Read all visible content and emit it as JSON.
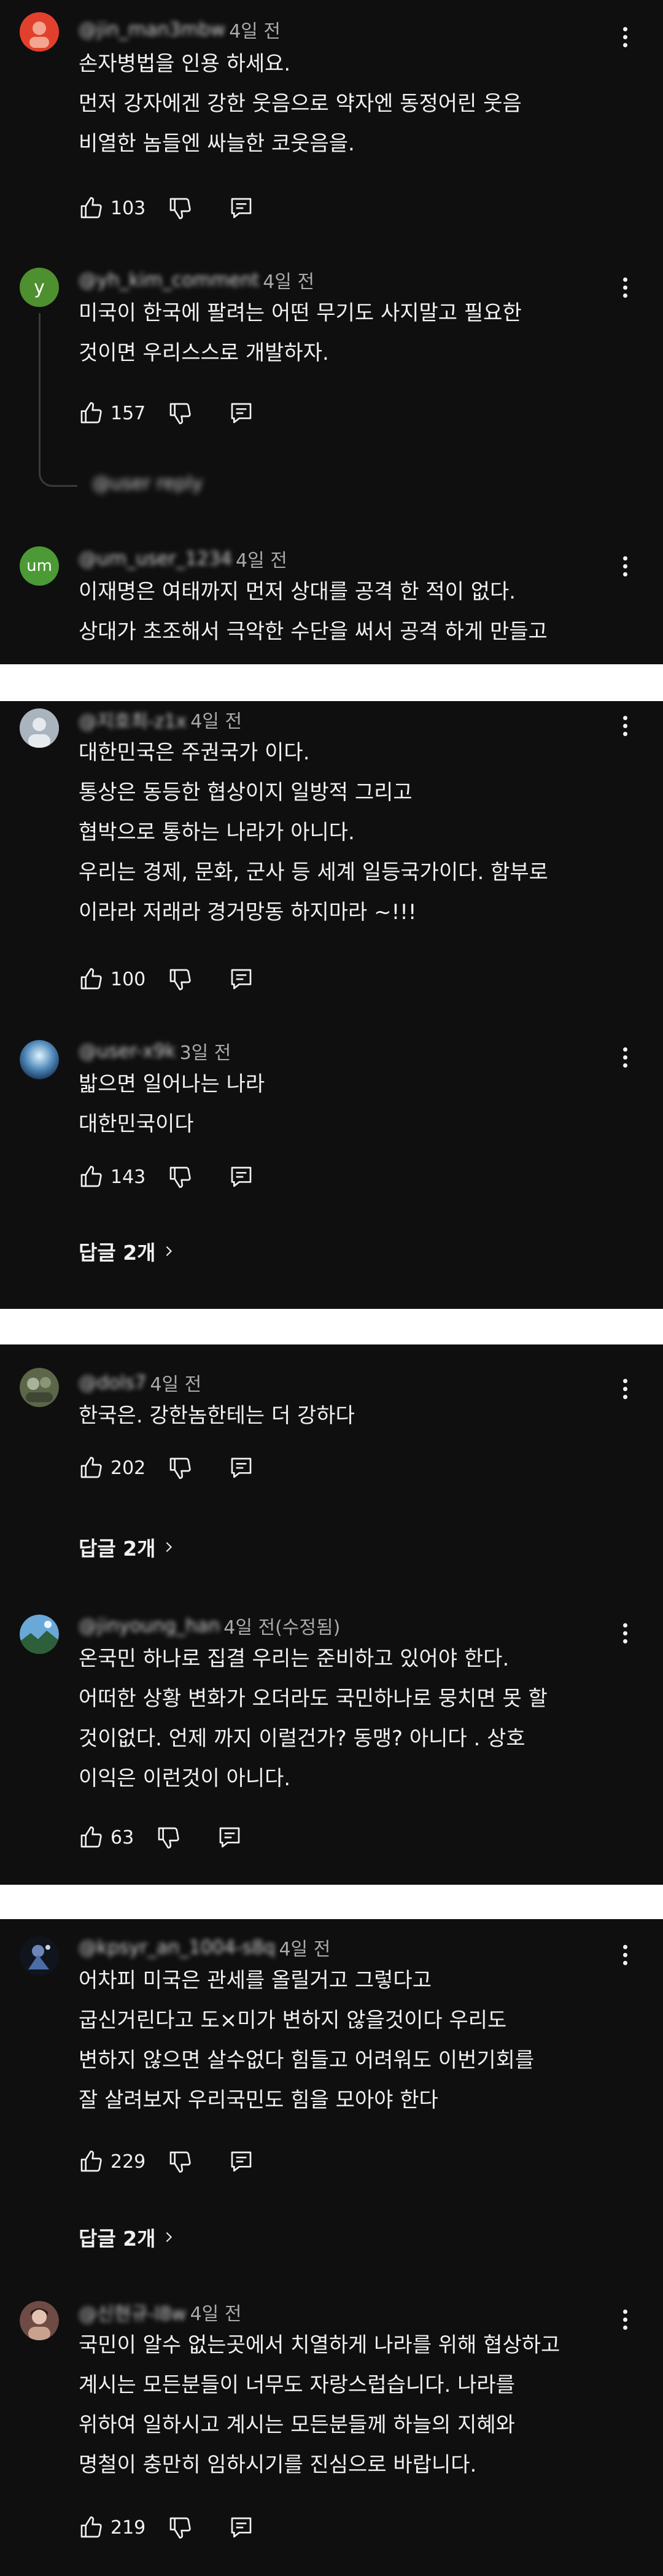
{
  "comments": [
    {
      "handle": "@jin_man3mbw",
      "age": "4일 전",
      "text": "손자병법을 인용 하세요.\n먼저 강자에겐 강한 웃음으로 약자엔 동정어린 웃음\n비열한 놈들엔 싸늘한 코웃음을.",
      "likes": "103"
    },
    {
      "avatar_letter": "y",
      "handle": "@yh_kim_comment",
      "age": "4일 전",
      "text": "미국이 한국에 팔려는 어떤 무기도 사지말고 필요한\n것이면 우리스스로 개발하자.",
      "likes": "157",
      "reply_preview": "@user reply"
    },
    {
      "avatar_letter": "um",
      "handle": "@um_user_1234",
      "age": "4일 전",
      "text": "이재명은 여태까지 먼저 상대를 공격 한 적이 없다.\n상대가 초조해서 극악한 수단을 써서 공격 하게 만들고"
    },
    {
      "handle": "@지호최-z1x",
      "age": "4일 전",
      "text": "대한민국은 주권국가 이다.\n통상은 동등한 협상이지 일방적 그리고\n협박으로 통하는 나라가 아니다.\n우리는 경제, 문화, 군사 등 세계 일등국가이다.  함부로\n이라라 저래라 경거망동 하지마라 ~!!!",
      "likes": "100"
    },
    {
      "handle": "@user-x9k",
      "age": "3일 전",
      "text": "밟으면 일어나는 나라\n대한민국이다",
      "likes": "143",
      "replies": "답글 2개"
    },
    {
      "handle": "@dols7",
      "age": "4일 전",
      "text": "한국은. 강한놈한테는 더 강하다",
      "likes": "202",
      "replies": "답글 2개"
    },
    {
      "handle": "@jinyoung_han",
      "age": "4일 전(수정됨)",
      "text": "온국민 하나로 집결  우리는 준비하고 있어야 한다.\n어떠한 상황 변화가 오더라도 국민하나로 뭉치면  못 할\n것이없다. 언제 까지 이럴건가?  동맹?  아니다 . 상호\n이익은 이런것이 아니다.",
      "likes": "63"
    },
    {
      "handle": "@kpsyr_an_1004-s8q",
      "age": "4일 전",
      "text": "어차피  미국은  관세를 올릴거고  그렇다고\n굽신거린다고  도×미가 변하지  않을것이다  우리도\n변하지  않으면  살수없다  힘들고  어려워도 이번기회를\n잘  살려보자  우리국민도  힘을  모아야 한다",
      "likes": "229",
      "replies": "답글 2개"
    },
    {
      "handle": "@신현규-l8w",
      "age": "4일 전",
      "text": "국민이 알수 없는곳에서 치열하게 나라를 위해 협상하고\n계시는 모든분들이 너무도 자랑스럽습니다. 나라를\n위하여 일하시고 계시는 모든분들께 하늘의 지혜와\n명철이 충만히 임하시기를 진심으로 바랍니다.",
      "likes": "219"
    }
  ],
  "colors": {
    "background": "#0f0f0f",
    "text": "#f1f1f1",
    "meta": "#aaaaaa"
  },
  "icons": [
    "like-icon",
    "dislike-icon",
    "reply-icon",
    "more-vert-icon",
    "chevron-right-icon"
  ]
}
